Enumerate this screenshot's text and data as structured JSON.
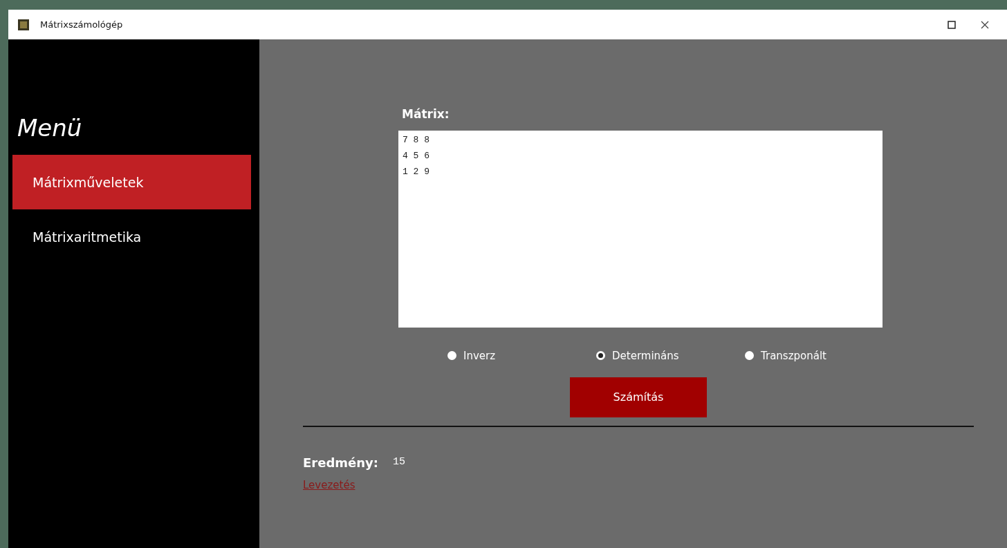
{
  "window": {
    "title": "Mátrixszámológép"
  },
  "sidebar": {
    "title": "Menü",
    "items": [
      {
        "label": "Mátrixműveletek",
        "selected": true
      },
      {
        "label": "Mátrixaritmetika",
        "selected": false
      }
    ]
  },
  "matrix": {
    "label": "Mátrix:",
    "value": "7 8 8\n4 5 6\n1 2 9"
  },
  "operations": [
    {
      "label": "Inverz",
      "selected": false
    },
    {
      "label": "Determináns",
      "selected": true
    },
    {
      "label": "Transzponált",
      "selected": false
    }
  ],
  "calculate_button": "Számítás",
  "result": {
    "label": "Eredmény:",
    "value": "15",
    "link": "Levezetés"
  }
}
